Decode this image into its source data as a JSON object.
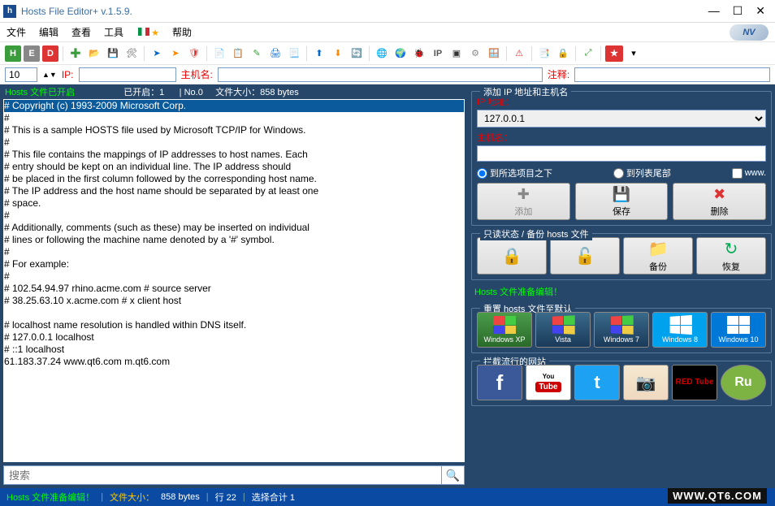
{
  "window": {
    "title": "Hosts File Editor+ v.1.5.9."
  },
  "menu": {
    "file": "文件",
    "edit": "编辑",
    "view": "查看",
    "tools": "工具",
    "help": "帮助"
  },
  "params": {
    "num_value": "10",
    "ip_label": "IP:",
    "host_label": "主机名:",
    "comment_label": "注释:"
  },
  "leftheader": {
    "status": "Hosts 文件已开启",
    "opened": "已开启：1",
    "no": "| No.0",
    "size_lbl": "文件大小：",
    "size": "858 bytes"
  },
  "editor_lines": [
    "# Copyright (c) 1993-2009 Microsoft Corp.",
    "#",
    "# This is a sample HOSTS file used by Microsoft TCP/IP for Windows.",
    "#",
    "# This file contains the mappings of IP addresses to host names. Each",
    "# entry should be kept on an individual line. The IP address should",
    "# be placed in the first column followed by the corresponding host name.",
    "# The IP address and the host name should be separated by at least one",
    "# space.",
    "#",
    "# Additionally, comments (such as these) may be inserted on individual",
    "# lines or following the machine name denoted by a '#' symbol.",
    "#",
    "# For example:",
    "#",
    "#      102.54.94.97     rhino.acme.com          # source server",
    "#       38.25.63.10     x.acme.com              # x client host",
    "",
    "# localhost name resolution is handled within DNS itself.",
    "#              127.0.0.1       localhost",
    "#              ::1             localhost",
    "61.183.37.24 www.qt6.com m.qt6.com"
  ],
  "search": {
    "placeholder": "搜索"
  },
  "right": {
    "group_add_title": "添加 IP 地址和主机名",
    "ip_label": "IP 地址：",
    "ip_value": "127.0.0.1",
    "host_label": "主机名：",
    "radio_below": "到所选项目之下",
    "radio_end": "到列表尾部",
    "chk_www": "www.",
    "btn_add": "添加",
    "btn_save": "保存",
    "btn_delete": "删除",
    "group_lock_title": "只读状态 / 备份 hosts 文件",
    "btn_backup": "备份",
    "btn_restore": "恢复",
    "ready_edit": "Hosts 文件准备编辑！",
    "group_reset_title": "重置 hosts 文件至默认",
    "os_xp": "Windows XP",
    "os_vista": "Vista",
    "os_7": "Windows 7",
    "os_8": "Windows 8",
    "os_10": "Windows 10",
    "group_block_title": "拦截流行的网站",
    "site_redtube": "RED Tube"
  },
  "statusbar": {
    "ready": "Hosts 文件准备编辑！",
    "size_lbl": "文件大小：",
    "size": "858 bytes",
    "line": "行 22",
    "selected": "选择合计 1"
  },
  "watermark": "WWW.QT6.COM"
}
